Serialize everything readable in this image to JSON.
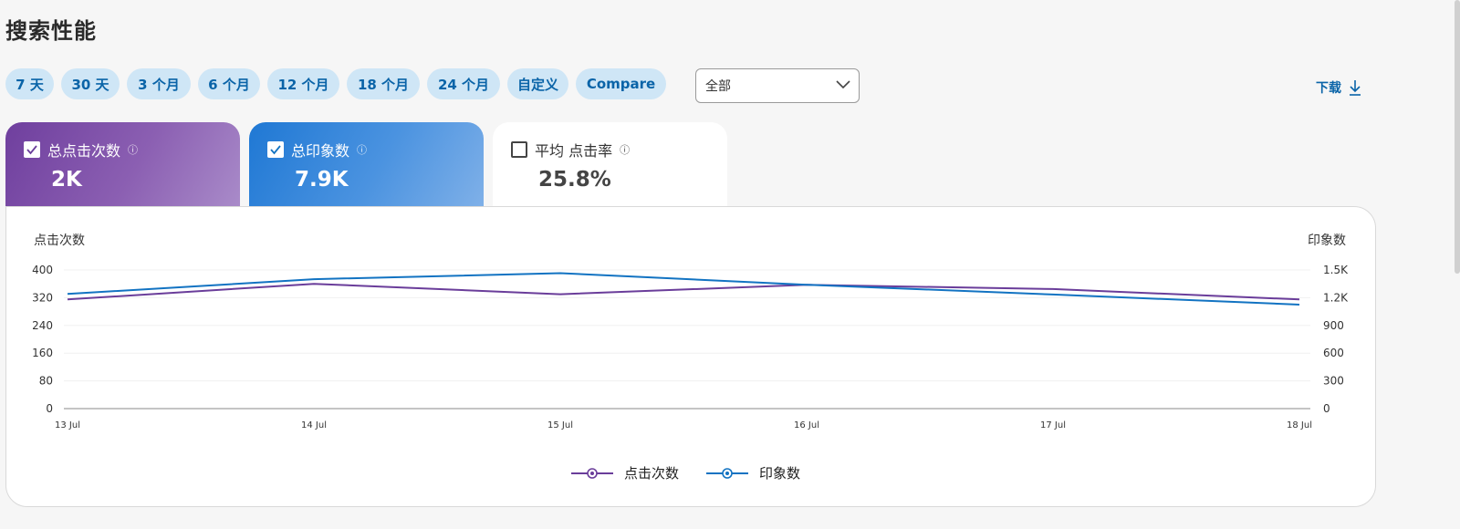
{
  "page": {
    "title": "搜索性能"
  },
  "ranges": [
    {
      "label": "7 天",
      "active": true
    },
    {
      "label": "30 天",
      "active": false
    },
    {
      "label": "3 个月",
      "active": false
    },
    {
      "label": "6 个月",
      "active": false
    },
    {
      "label": "12 个月",
      "active": false
    },
    {
      "label": "18 个月",
      "active": false
    },
    {
      "label": "24 个月",
      "active": false
    },
    {
      "label": "自定义",
      "active": false
    },
    {
      "label": "Compare",
      "active": false
    }
  ],
  "filter": {
    "selected": "全部"
  },
  "download": {
    "label": "下载"
  },
  "metrics": {
    "clicks": {
      "label": "总点击次数",
      "value": "2K",
      "checked": true
    },
    "impressions": {
      "label": "总印象数",
      "value": "7.9K",
      "checked": true
    },
    "ctr": {
      "label": "平均 点击率",
      "value": "25.8%",
      "checked": false
    }
  },
  "colors": {
    "clicks": "#6a3d9a",
    "impressions": "#1273c2"
  },
  "chart_data": {
    "type": "line",
    "x": [
      "13 Jul",
      "14 Jul",
      "15 Jul",
      "16 Jul",
      "17 Jul",
      "18 Jul"
    ],
    "y_left": {
      "label": "点击次数",
      "range": [
        0,
        400
      ],
      "ticks": [
        "0",
        "80",
        "160",
        "240",
        "320",
        "400"
      ]
    },
    "y_right": {
      "label": "印象数",
      "range": [
        0,
        1500
      ],
      "ticks": [
        "0",
        "300",
        "600",
        "900",
        "1.2K",
        "1.5K"
      ]
    },
    "series": [
      {
        "name": "点击次数",
        "axis": "left",
        "values": [
          315,
          360,
          330,
          357,
          345,
          315
        ]
      },
      {
        "name": "印象数",
        "axis": "right",
        "values": [
          1240,
          1400,
          1465,
          1340,
          1235,
          1125
        ]
      }
    ],
    "grid": true,
    "legend": "bottom-center"
  }
}
